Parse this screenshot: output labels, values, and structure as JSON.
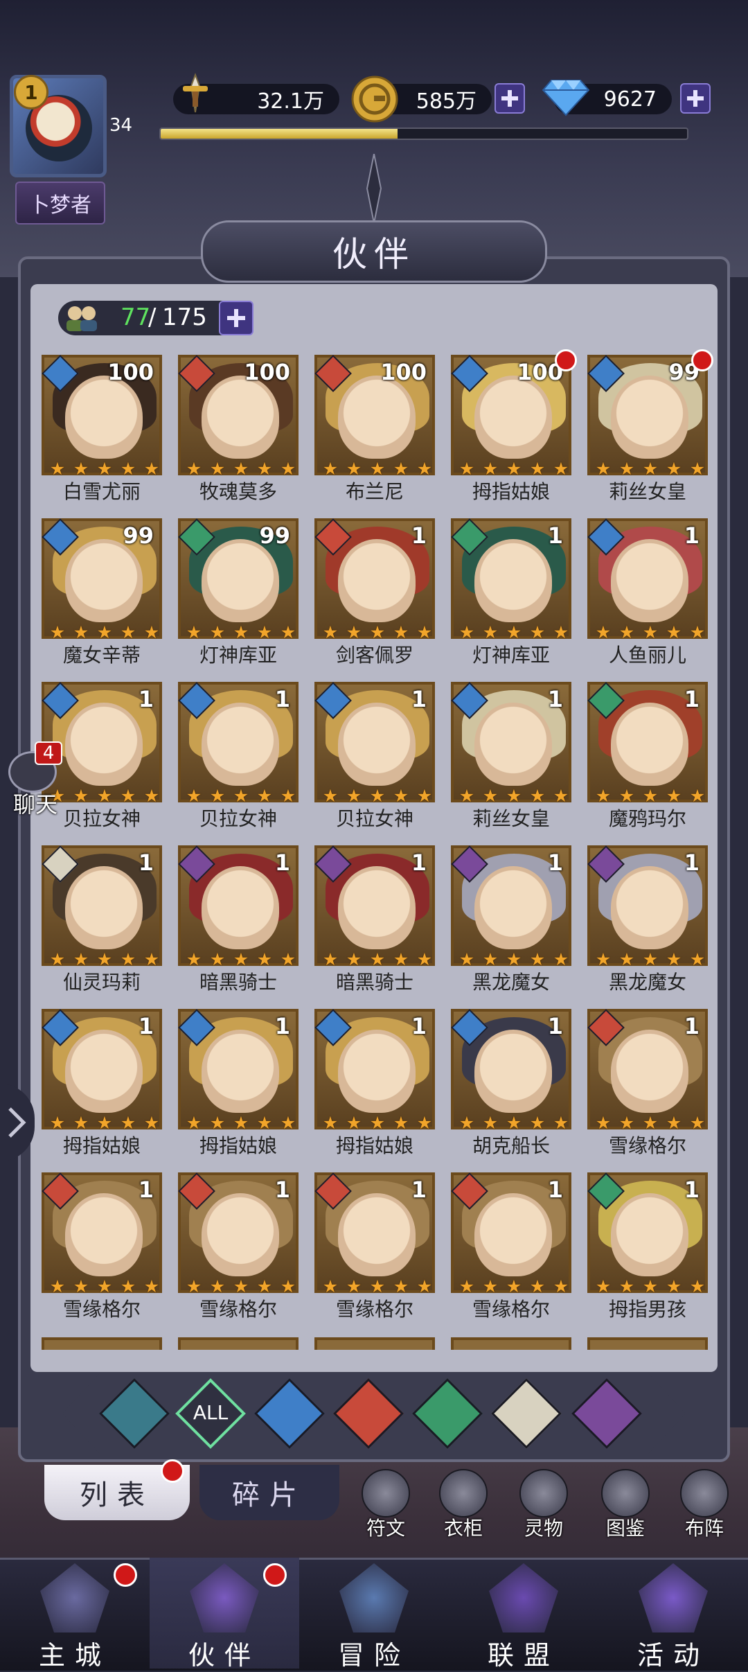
{
  "player": {
    "vip_level": "1",
    "name": "卜梦者",
    "level": "34",
    "exp_fraction": 0.45
  },
  "resources": {
    "power": "32.1万",
    "gold": "585万",
    "gems": "9627"
  },
  "panel": {
    "title": "伙伴",
    "count_current": "77",
    "count_slash": "/",
    "count_total": "175"
  },
  "heroes": [
    {
      "name": "白雪尤丽",
      "level": "100",
      "element": "water",
      "stars": 5,
      "reddot": false
    },
    {
      "name": "牧魂莫多",
      "level": "100",
      "element": "fire",
      "stars": 5,
      "reddot": false
    },
    {
      "name": "布兰尼",
      "level": "100",
      "element": "fire",
      "stars": 5,
      "reddot": false
    },
    {
      "name": "拇指姑娘",
      "level": "100",
      "element": "water",
      "stars": 5,
      "reddot": true
    },
    {
      "name": "莉丝女皇",
      "level": "99",
      "element": "water",
      "stars": 5,
      "reddot": true
    },
    {
      "name": "魔女辛蒂",
      "level": "99",
      "element": "water",
      "stars": 5,
      "reddot": false
    },
    {
      "name": "灯神库亚",
      "level": "99",
      "element": "wind",
      "stars": 5,
      "reddot": false
    },
    {
      "name": "剑客佩罗",
      "level": "1",
      "element": "fire",
      "stars": 5,
      "reddot": false
    },
    {
      "name": "灯神库亚",
      "level": "1",
      "element": "wind",
      "stars": 5,
      "reddot": false
    },
    {
      "name": "人鱼丽儿",
      "level": "1",
      "element": "water",
      "stars": 5,
      "reddot": false
    },
    {
      "name": "贝拉女神",
      "level": "1",
      "element": "water",
      "stars": 5,
      "reddot": false
    },
    {
      "name": "贝拉女神",
      "level": "1",
      "element": "water",
      "stars": 5,
      "reddot": false
    },
    {
      "name": "贝拉女神",
      "level": "1",
      "element": "water",
      "stars": 5,
      "reddot": false
    },
    {
      "name": "莉丝女皇",
      "level": "1",
      "element": "water",
      "stars": 5,
      "reddot": false
    },
    {
      "name": "魔鸦玛尔",
      "level": "1",
      "element": "wind",
      "stars": 5,
      "reddot": false
    },
    {
      "name": "仙灵玛莉",
      "level": "1",
      "element": "light",
      "stars": 5,
      "reddot": false
    },
    {
      "name": "暗黑骑士",
      "level": "1",
      "element": "dark",
      "stars": 5,
      "reddot": false
    },
    {
      "name": "暗黑骑士",
      "level": "1",
      "element": "dark",
      "stars": 5,
      "reddot": false
    },
    {
      "name": "黑龙魔女",
      "level": "1",
      "element": "dark",
      "stars": 5,
      "reddot": false
    },
    {
      "name": "黑龙魔女",
      "level": "1",
      "element": "dark",
      "stars": 5,
      "reddot": false
    },
    {
      "name": "拇指姑娘",
      "level": "1",
      "element": "water",
      "stars": 5,
      "reddot": false
    },
    {
      "name": "拇指姑娘",
      "level": "1",
      "element": "water",
      "stars": 5,
      "reddot": false
    },
    {
      "name": "拇指姑娘",
      "level": "1",
      "element": "water",
      "stars": 5,
      "reddot": false
    },
    {
      "name": "胡克船长",
      "level": "1",
      "element": "water",
      "stars": 5,
      "reddot": false
    },
    {
      "name": "雪缘格尔",
      "level": "1",
      "element": "fire",
      "stars": 5,
      "reddot": false
    },
    {
      "name": "雪缘格尔",
      "level": "1",
      "element": "fire",
      "stars": 5,
      "reddot": false
    },
    {
      "name": "雪缘格尔",
      "level": "1",
      "element": "fire",
      "stars": 5,
      "reddot": false
    },
    {
      "name": "雪缘格尔",
      "level": "1",
      "element": "fire",
      "stars": 5,
      "reddot": false
    },
    {
      "name": "雪缘格尔",
      "level": "1",
      "element": "fire",
      "stars": 5,
      "reddot": false
    },
    {
      "name": "拇指男孩",
      "level": "1",
      "element": "wind",
      "stars": 5,
      "reddot": false
    }
  ],
  "element_colors": {
    "water": "#3f7fc8",
    "fire": "#c84a3a",
    "wind": "#3a9a6a",
    "light": "#d8d2c0",
    "dark": "#7a4a9a"
  },
  "filters": [
    {
      "name": "arcane-icon",
      "text": "",
      "color": "#3a7a8a"
    },
    {
      "name": "all-icon",
      "text": "ALL",
      "color": "#2f3040",
      "active": true
    },
    {
      "name": "water-icon",
      "text": "",
      "color": "#3f7fc8"
    },
    {
      "name": "fire-icon",
      "text": "",
      "color": "#c84a3a"
    },
    {
      "name": "wind-icon",
      "text": "",
      "color": "#3a9a6a"
    },
    {
      "name": "light-icon",
      "text": "",
      "color": "#d8d2c0"
    },
    {
      "name": "dark-icon",
      "text": "",
      "color": "#7a4a9a"
    }
  ],
  "subtabs": {
    "list": "列表",
    "fragments": "碎片"
  },
  "tools": [
    {
      "label": "符文",
      "icon": "rune-icon"
    },
    {
      "label": "衣柜",
      "icon": "wardrobe-icon"
    },
    {
      "label": "灵物",
      "icon": "spirit-icon"
    },
    {
      "label": "图鉴",
      "icon": "codex-icon"
    },
    {
      "label": "布阵",
      "icon": "formation-icon"
    }
  ],
  "chat": {
    "label": "聊天",
    "badge": "4"
  },
  "nav": [
    {
      "label": "主城",
      "icon": "castle-icon",
      "reddot": true
    },
    {
      "label": "伙伴",
      "icon": "partner-icon",
      "reddot": true,
      "active": true
    },
    {
      "label": "冒险",
      "icon": "compass-icon",
      "reddot": false
    },
    {
      "label": "联盟",
      "icon": "shield-icon",
      "reddot": false
    },
    {
      "label": "活动",
      "icon": "cards-icon",
      "reddot": false
    }
  ]
}
